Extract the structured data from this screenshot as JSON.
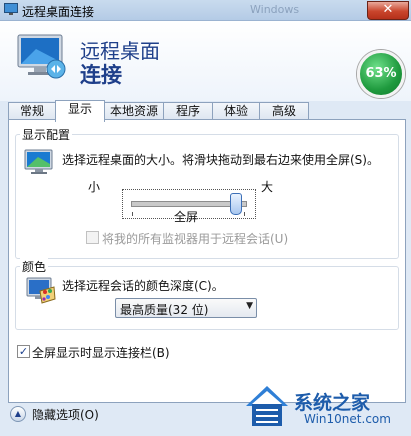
{
  "window": {
    "title": "远程桌面连接",
    "background_title": "Windows"
  },
  "header": {
    "line1": "远程桌面",
    "line2": "连接",
    "progress_badge": "63%"
  },
  "tabs": [
    "常规",
    "显示",
    "本地资源",
    "程序",
    "体验",
    "高级"
  ],
  "active_tab": "显示",
  "display_config": {
    "group_title": "显示配置",
    "description": "选择远程桌面的大小。将滑块拖动到最右边来使用全屏(S)。",
    "slider_min_label": "小",
    "slider_max_label": "大",
    "slider_value_label": "全屏",
    "slider_level": 1.0,
    "multi_monitor_label": "将我的所有监视器用于远程会话(U)",
    "multi_monitor_checked": false,
    "multi_monitor_enabled": false
  },
  "colors": {
    "group_title": "颜色",
    "description": "选择远程会话的颜色深度(C)。",
    "selected_depth": "最高质量(32 位)"
  },
  "connection_bar": {
    "label": "全屏显示时显示连接栏(B)",
    "checked": true
  },
  "hide_options_label": "隐藏选项(O)",
  "watermark": {
    "text": "系统之家",
    "sub": "Win10net.com"
  },
  "theme": {
    "accent": "#1e3f8a",
    "badge_green": "#1f9a3e"
  }
}
